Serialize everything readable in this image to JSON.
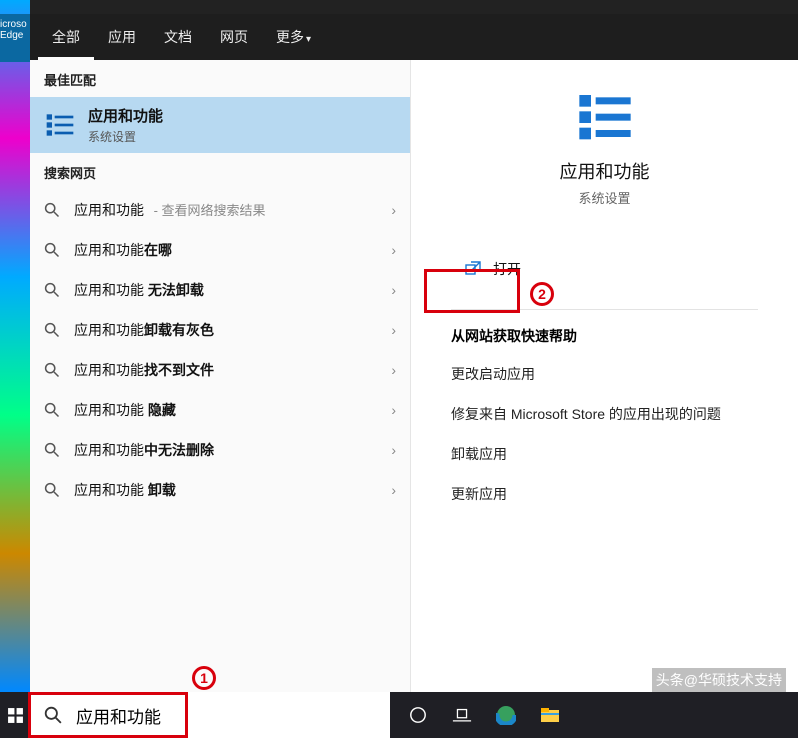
{
  "edge_tile": "icroso\nEdge",
  "tabs": {
    "all": "全部",
    "apps": "应用",
    "docs": "文档",
    "web": "网页",
    "more": "更多"
  },
  "section": {
    "best_match": "最佳匹配",
    "web_search": "搜索网页"
  },
  "best_match": {
    "title": "应用和功能",
    "subtitle": "系统设置"
  },
  "web_rows": [
    {
      "prefix": "应用和功能",
      "bold": "",
      "suffix": " - 查看网络搜索结果"
    },
    {
      "prefix": "应用和功能",
      "bold": "在哪",
      "suffix": ""
    },
    {
      "prefix": "应用和功能 ",
      "bold": "无法卸载",
      "suffix": ""
    },
    {
      "prefix": "应用和功能",
      "bold": "卸载有灰色",
      "suffix": ""
    },
    {
      "prefix": "应用和功能",
      "bold": "找不到文件",
      "suffix": ""
    },
    {
      "prefix": "应用和功能 ",
      "bold": "隐藏",
      "suffix": ""
    },
    {
      "prefix": "应用和功能",
      "bold": "中无法删除",
      "suffix": ""
    },
    {
      "prefix": "应用和功能 ",
      "bold": "卸载",
      "suffix": ""
    }
  ],
  "detail": {
    "title": "应用和功能",
    "subtitle": "系统设置",
    "open": "打开",
    "quick_help_title": "从网站获取快速帮助",
    "quick_links": [
      "更改启动应用",
      "修复来自 Microsoft Store 的应用出现的问题",
      "卸载应用",
      "更新应用"
    ]
  },
  "search_value": "应用和功能",
  "watermark": "头条@华硕技术支持",
  "annotations": {
    "one": "1",
    "two": "2"
  }
}
